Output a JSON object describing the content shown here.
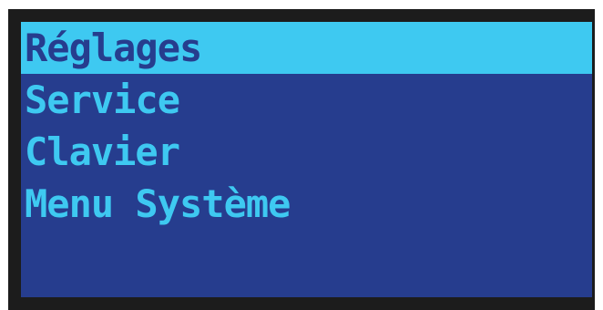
{
  "menu": {
    "items": [
      {
        "label": "Réglages",
        "selected": true
      },
      {
        "label": "Service",
        "selected": false
      },
      {
        "label": "Clavier",
        "selected": false
      },
      {
        "label": "Menu Système",
        "selected": false
      }
    ]
  },
  "colors": {
    "frame": "#1c1c1c",
    "screen_background": "#263d8e",
    "text": "#3ec9f1",
    "highlight": "#3ec9f1"
  }
}
